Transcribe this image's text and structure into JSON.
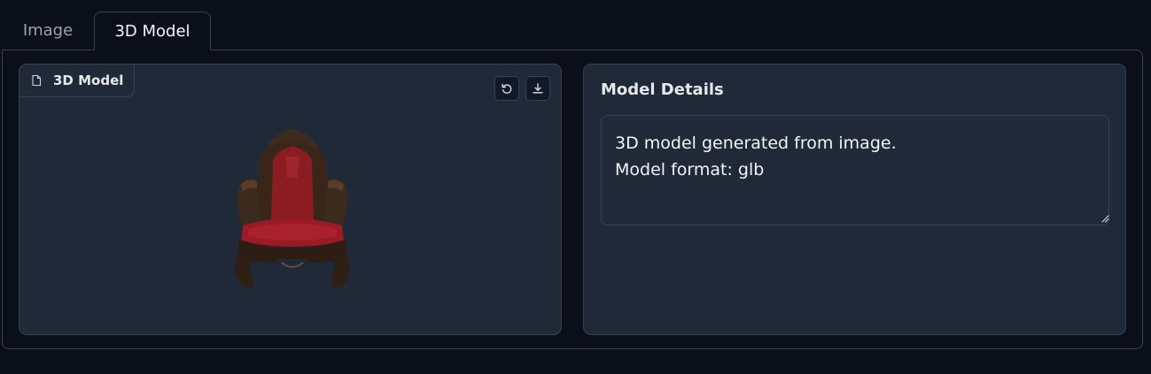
{
  "tabs": [
    {
      "label": "Image",
      "active": false
    },
    {
      "label": "3D Model",
      "active": true
    }
  ],
  "model_panel": {
    "label": "3D Model",
    "label_icon": "file-icon",
    "actions": [
      {
        "icon": "undo-icon",
        "name": "reset-view"
      },
      {
        "icon": "download-icon",
        "name": "download"
      }
    ]
  },
  "details_panel": {
    "title": "Model Details",
    "lines": [
      "3D model generated from image.",
      "Model format: glb"
    ]
  },
  "colors": {
    "background": "#0b0f19",
    "panel": "#1f2937",
    "border": "#374151",
    "text": "#e5e7eb",
    "muted_text": "#9ca3af"
  }
}
